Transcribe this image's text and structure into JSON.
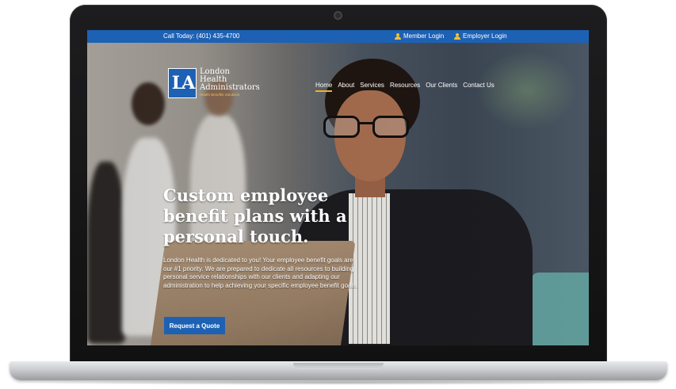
{
  "topbar": {
    "phone": "Call Today: (401) 435-4700",
    "member_login": "Member Login",
    "employer_login": "Employer Login",
    "icons": [
      "user-icon",
      "user-icon"
    ]
  },
  "logo": {
    "mark": "LA",
    "line1": "London",
    "line2": "Health",
    "line3": "Administrators",
    "tagline": "Health Benefits Solutions"
  },
  "nav": {
    "items": [
      "Home",
      "About",
      "Services",
      "Resources",
      "Our Clients",
      "Contact Us"
    ],
    "active": "Home"
  },
  "hero": {
    "headline_1": "Custom employee",
    "headline_2": "benefit plans with a",
    "headline_3": "personal touch.",
    "body": "London Health is dedicated to you! Your employee benefit goals are our #1 priority. We are prepared to dedicate all resources to building personal service relationships with our clients and adapting our administration to help achieving your specific employee benefit goals.",
    "cta": "Request a Quote"
  },
  "colors": {
    "brand_blue": "#1d61b4",
    "accent_gold": "#e8b62c"
  }
}
